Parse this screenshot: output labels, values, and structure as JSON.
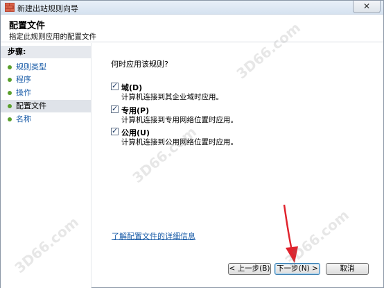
{
  "window": {
    "title": "新建出站规则向导",
    "close_symbol": "✕"
  },
  "header": {
    "title": "配置文件",
    "subtitle": "指定此规则应用的配置文件"
  },
  "sidebar": {
    "steps_label": "步骤:",
    "items": [
      {
        "label": "规则类型",
        "state": "link"
      },
      {
        "label": "程序",
        "state": "link"
      },
      {
        "label": "操作",
        "state": "link"
      },
      {
        "label": "配置文件",
        "state": "current"
      },
      {
        "label": "名称",
        "state": "link"
      }
    ]
  },
  "main": {
    "question": "何时应用该规则?",
    "options": [
      {
        "label": "域(D)",
        "description": "计算机连接到其企业域时应用。",
        "checked": true
      },
      {
        "label": "专用(P)",
        "description": "计算机连接到专用网络位置时应用。",
        "checked": true
      },
      {
        "label": "公用(U)",
        "description": "计算机连接到公用网络位置时应用。",
        "checked": true
      }
    ],
    "learn_more_link": "了解配置文件的详细信息"
  },
  "buttons": {
    "back": "< 上一步(B)",
    "next": "下一步(N) >",
    "cancel": "取消"
  },
  "watermarks": [
    "3D66.com",
    "3D66.com",
    "3D66.com",
    "3D66.com"
  ],
  "colors": {
    "link": "#1a5ca8",
    "step_dot": "#5aa02c",
    "arrow": "#e0232d"
  }
}
